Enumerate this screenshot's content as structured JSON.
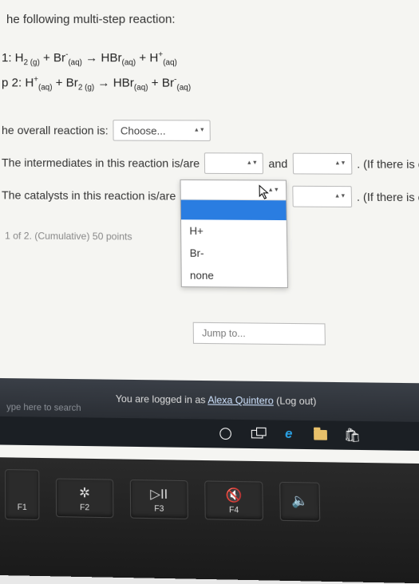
{
  "prompt": "he following multi-step reaction:",
  "step1_prefix": "1:",
  "step2_prefix": "p 2:",
  "arrow": "→",
  "q_overall_label": "he overall reaction is:",
  "choose_label": "Choose...",
  "q_intermediates_label": "The intermediates in this reaction is/are",
  "and_label": "and",
  "paren_one_partial": ". (If there is on",
  "q_catalysts_label": "The catalysts in this reaction is/are",
  "paren_only_one_partial": ". (If there is only one",
  "dropdown": {
    "options": [
      "",
      "H+",
      "Br-",
      "none"
    ]
  },
  "progress": "1 of 2. (Cumulative) 50 points",
  "jump_placeholder": "Jump to...",
  "footer_logged": "You are logged in as ",
  "footer_user": "Alexa Quintero",
  "footer_logout": " (Log out)",
  "search_hint": "ype here to search",
  "keys": {
    "f1": "F1",
    "f2": "F2",
    "f3": "F3",
    "f4": "F4",
    "f2_glyph": "✲",
    "f3_glyph": "▷II",
    "f4_glyph": "🔇",
    "f5_glyph": "🔈"
  }
}
